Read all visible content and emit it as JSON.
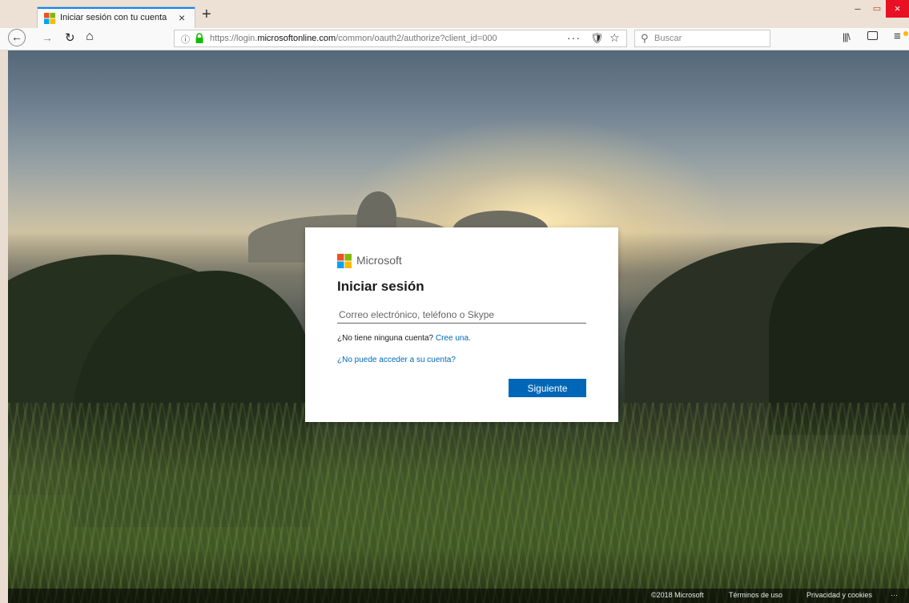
{
  "browser": {
    "tab": {
      "title": "Iniciar sesión con tu cuenta",
      "close": "×"
    },
    "new_tab": "+",
    "window": {
      "minimize": "–",
      "maximize": "▭",
      "close": "×"
    },
    "nav": {
      "back": "←",
      "forward": "→",
      "reload": "↻",
      "home": "⌂"
    },
    "url": {
      "prefix": "https://login.",
      "domain": "microsoftonline.com",
      "path": "/common/oauth2/authorize?client_id=000",
      "more": "···",
      "info": "ⓘ"
    },
    "search": {
      "placeholder": "Buscar"
    }
  },
  "signin": {
    "brand": "Microsoft",
    "title": "Iniciar sesión",
    "email_placeholder": "Correo electrónico, teléfono o Skype",
    "no_account_text": "¿No tiene ninguna cuenta?",
    "create_link": "Cree una.",
    "cant_access_link": "¿No puede acceder a su cuenta?",
    "next_button": "Siguiente"
  },
  "footer": {
    "copyright": "©2018 Microsoft",
    "terms": "Términos de uso",
    "privacy": "Privacidad y cookies",
    "more": "···"
  },
  "colors": {
    "accent": "#0067b8",
    "ms_red": "#f25022",
    "ms_green": "#7fba00",
    "ms_blue": "#00a4ef",
    "ms_yellow": "#ffb900"
  }
}
